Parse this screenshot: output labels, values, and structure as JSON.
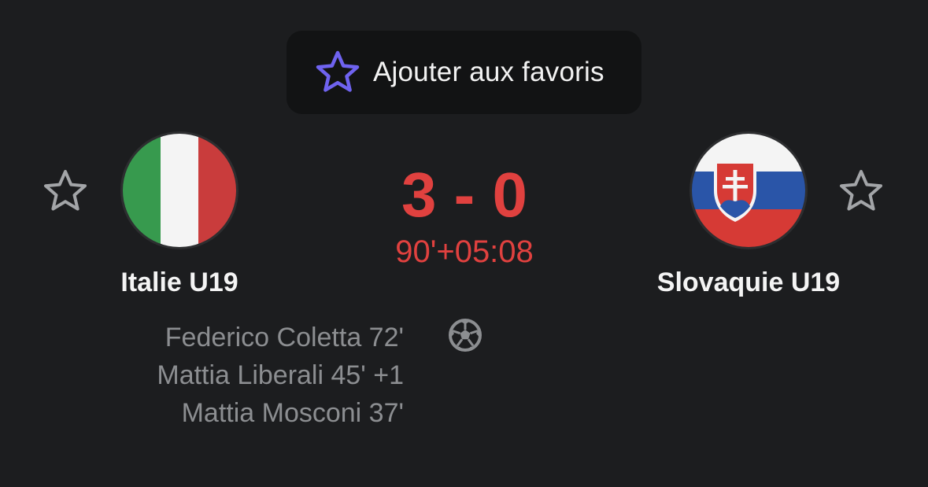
{
  "favorite_button": {
    "label": "Ajouter aux favoris",
    "icon": "star-outline-icon",
    "icon_color": "#6f63f0"
  },
  "match": {
    "score": "3 - 0",
    "clock": "90'+05:08",
    "score_color": "#e0413f"
  },
  "home_team": {
    "name": "Italie U19",
    "flag": "italy-flag-icon"
  },
  "away_team": {
    "name": "Slovaquie U19",
    "flag": "slovakia-flag-icon"
  },
  "home_scorers": [
    {
      "text": "Federico Coletta 72'"
    },
    {
      "text": "Mattia Liberali 45' +1"
    },
    {
      "text": "Mattia Mosconi 37'"
    }
  ],
  "goal_icon": "soccer-ball-icon"
}
